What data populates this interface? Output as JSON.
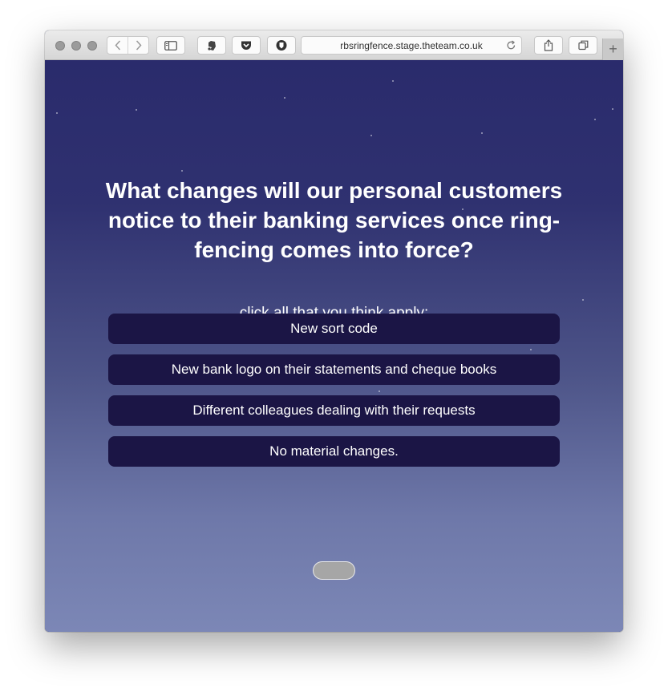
{
  "browser": {
    "url": "rbsringfence.stage.theteam.co.uk",
    "new_tab_label": "+"
  },
  "quiz": {
    "question": "What changes will our personal customers notice to their banking services once ring-fencing comes into force?",
    "instruction": "click all that you think apply:",
    "options": [
      {
        "label": "New sort code"
      },
      {
        "label": "New bank logo on their statements and cheque books"
      },
      {
        "label": "Different colleagues dealing with their requests"
      },
      {
        "label": "No material changes."
      }
    ]
  },
  "colors": {
    "option_background": "#1b1545",
    "background_top": "#2a2b6c",
    "background_bottom": "#7c87b6",
    "submit_button": "#a6a6a6"
  },
  "icons": {
    "back": "chevron-left-icon",
    "forward": "chevron-right-icon",
    "sidebar": "sidebar-icon",
    "evernote": "evernote-icon",
    "pocket": "pocket-icon",
    "shield": "shield-icon",
    "reload": "reload-icon",
    "share": "share-icon",
    "tabs": "tabs-icon"
  }
}
